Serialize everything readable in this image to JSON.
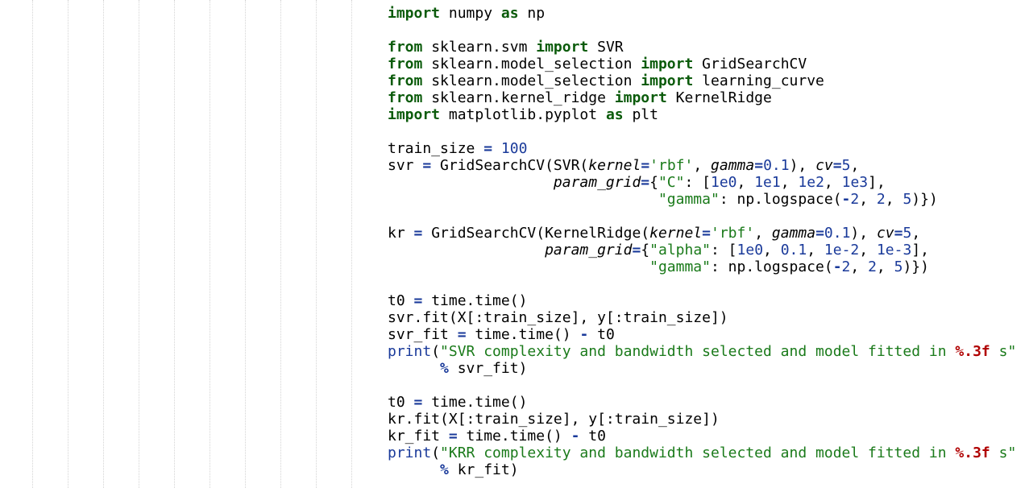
{
  "colors": {
    "background": "#ffffff",
    "keyword": "#0b5b0b",
    "builtin_and_numbers": "#1a3a9a",
    "string": "#1a7a1a",
    "format_spec": "#b00000"
  },
  "lines": [
    [
      [
        "kw",
        "import"
      ],
      [
        "t",
        " numpy "
      ],
      [
        "kw",
        "as"
      ],
      [
        "t",
        " np"
      ]
    ],
    [],
    [
      [
        "kw",
        "from"
      ],
      [
        "t",
        " sklearn.svm "
      ],
      [
        "kw",
        "import"
      ],
      [
        "t",
        " SVR"
      ]
    ],
    [
      [
        "kw",
        "from"
      ],
      [
        "t",
        " sklearn.model_selection "
      ],
      [
        "kw",
        "import"
      ],
      [
        "t",
        " GridSearchCV"
      ]
    ],
    [
      [
        "kw",
        "from"
      ],
      [
        "t",
        " sklearn.model_selection "
      ],
      [
        "kw",
        "import"
      ],
      [
        "t",
        " learning_curve"
      ]
    ],
    [
      [
        "kw",
        "from"
      ],
      [
        "t",
        " sklearn.kernel_ridge "
      ],
      [
        "kw",
        "import"
      ],
      [
        "t",
        " KernelRidge"
      ]
    ],
    [
      [
        "kw",
        "import"
      ],
      [
        "t",
        " matplotlib.pyplot "
      ],
      [
        "kw",
        "as"
      ],
      [
        "t",
        " plt"
      ]
    ],
    [],
    [
      [
        "t",
        "train_size "
      ],
      [
        "op",
        "="
      ],
      [
        "t",
        " "
      ],
      [
        "num",
        "100"
      ]
    ],
    [
      [
        "t",
        "svr "
      ],
      [
        "op",
        "="
      ],
      [
        "t",
        " GridSearchCV(SVR("
      ],
      [
        "arg",
        "kernel"
      ],
      [
        "op",
        "="
      ],
      [
        "str",
        "'rbf'"
      ],
      [
        "t",
        ", "
      ],
      [
        "arg",
        "gamma"
      ],
      [
        "op",
        "="
      ],
      [
        "num",
        "0.1"
      ],
      [
        "t",
        "), "
      ],
      [
        "arg",
        "cv"
      ],
      [
        "op",
        "="
      ],
      [
        "num",
        "5"
      ],
      [
        "t",
        ","
      ]
    ],
    [
      [
        "t",
        "                   "
      ],
      [
        "arg",
        "param_grid"
      ],
      [
        "op",
        "="
      ],
      [
        "t",
        "{"
      ],
      [
        "str",
        "\"C\""
      ],
      [
        "t",
        ": ["
      ],
      [
        "num",
        "1e0"
      ],
      [
        "t",
        ", "
      ],
      [
        "num",
        "1e1"
      ],
      [
        "t",
        ", "
      ],
      [
        "num",
        "1e2"
      ],
      [
        "t",
        ", "
      ],
      [
        "num",
        "1e3"
      ],
      [
        "t",
        "],"
      ]
    ],
    [
      [
        "t",
        "                               "
      ],
      [
        "str",
        "\"gamma\""
      ],
      [
        "t",
        ": np.logspace("
      ],
      [
        "op",
        "-"
      ],
      [
        "num",
        "2"
      ],
      [
        "t",
        ", "
      ],
      [
        "num",
        "2"
      ],
      [
        "t",
        ", "
      ],
      [
        "num",
        "5"
      ],
      [
        "t",
        ")})"
      ]
    ],
    [],
    [
      [
        "t",
        "kr "
      ],
      [
        "op",
        "="
      ],
      [
        "t",
        " GridSearchCV(KernelRidge("
      ],
      [
        "arg",
        "kernel"
      ],
      [
        "op",
        "="
      ],
      [
        "str",
        "'rbf'"
      ],
      [
        "t",
        ", "
      ],
      [
        "arg",
        "gamma"
      ],
      [
        "op",
        "="
      ],
      [
        "num",
        "0.1"
      ],
      [
        "t",
        "), "
      ],
      [
        "arg",
        "cv"
      ],
      [
        "op",
        "="
      ],
      [
        "num",
        "5"
      ],
      [
        "t",
        ","
      ]
    ],
    [
      [
        "t",
        "                  "
      ],
      [
        "arg",
        "param_grid"
      ],
      [
        "op",
        "="
      ],
      [
        "t",
        "{"
      ],
      [
        "str",
        "\"alpha\""
      ],
      [
        "t",
        ": ["
      ],
      [
        "num",
        "1e0"
      ],
      [
        "t",
        ", "
      ],
      [
        "num",
        "0.1"
      ],
      [
        "t",
        ", "
      ],
      [
        "num",
        "1e-2"
      ],
      [
        "t",
        ", "
      ],
      [
        "num",
        "1e-3"
      ],
      [
        "t",
        "],"
      ]
    ],
    [
      [
        "t",
        "                              "
      ],
      [
        "str",
        "\"gamma\""
      ],
      [
        "t",
        ": np.logspace("
      ],
      [
        "op",
        "-"
      ],
      [
        "num",
        "2"
      ],
      [
        "t",
        ", "
      ],
      [
        "num",
        "2"
      ],
      [
        "t",
        ", "
      ],
      [
        "num",
        "5"
      ],
      [
        "t",
        ")})"
      ]
    ],
    [],
    [
      [
        "t",
        "t0 "
      ],
      [
        "op",
        "="
      ],
      [
        "t",
        " time.time()"
      ]
    ],
    [
      [
        "t",
        "svr.fit(X[:train_size], y[:train_size])"
      ]
    ],
    [
      [
        "t",
        "svr_fit "
      ],
      [
        "op",
        "="
      ],
      [
        "t",
        " time.time() "
      ],
      [
        "op",
        "-"
      ],
      [
        "t",
        " t0"
      ]
    ],
    [
      [
        "bi",
        "print"
      ],
      [
        "t",
        "("
      ],
      [
        "str",
        "\"SVR complexity and bandwidth selected and model fitted in "
      ],
      [
        "fmt",
        "%.3f"
      ],
      [
        "str",
        " s\""
      ]
    ],
    [
      [
        "t",
        "      "
      ],
      [
        "op",
        "%"
      ],
      [
        "t",
        " svr_fit)"
      ]
    ],
    [],
    [
      [
        "t",
        "t0 "
      ],
      [
        "op",
        "="
      ],
      [
        "t",
        " time.time()"
      ]
    ],
    [
      [
        "t",
        "kr.fit(X[:train_size], y[:train_size])"
      ]
    ],
    [
      [
        "t",
        "kr_fit "
      ],
      [
        "op",
        "="
      ],
      [
        "t",
        " time.time() "
      ],
      [
        "op",
        "-"
      ],
      [
        "t",
        " t0"
      ]
    ],
    [
      [
        "bi",
        "print"
      ],
      [
        "t",
        "("
      ],
      [
        "str",
        "\"KRR complexity and bandwidth selected and model fitted in "
      ],
      [
        "fmt",
        "%.3f"
      ],
      [
        "str",
        " s\""
      ]
    ],
    [
      [
        "t",
        "      "
      ],
      [
        "op",
        "%"
      ],
      [
        "t",
        " kr_fit)"
      ]
    ]
  ]
}
